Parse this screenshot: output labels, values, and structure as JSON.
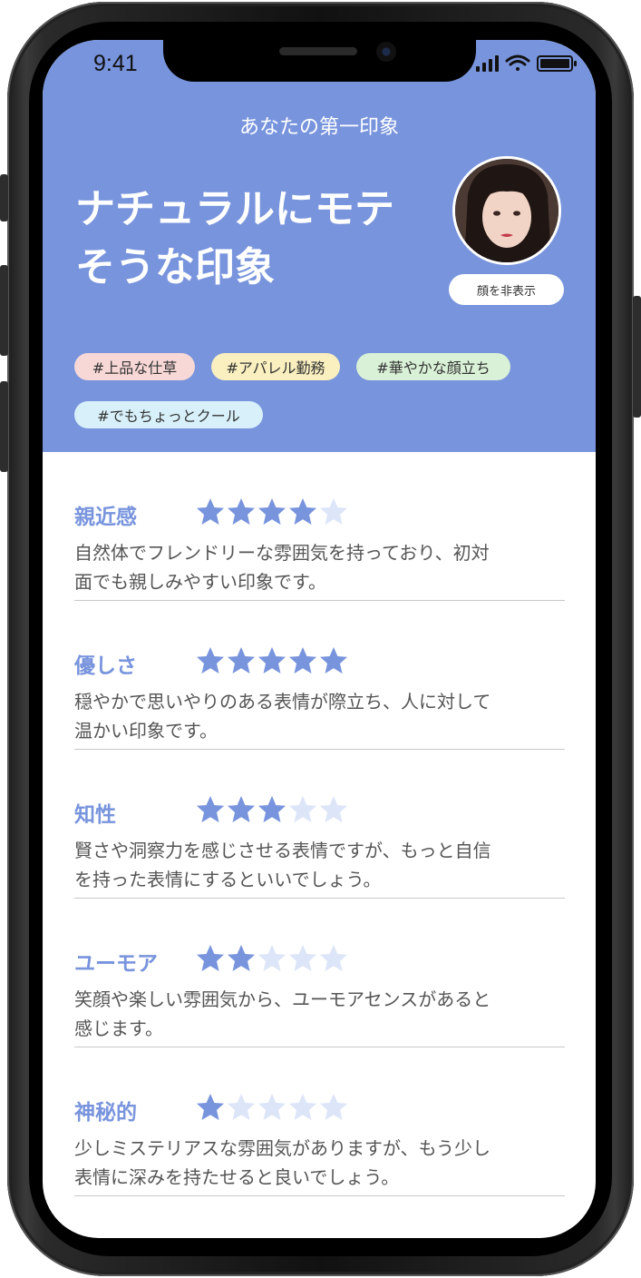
{
  "status_bar": {
    "time": "9:41"
  },
  "header": {
    "title": "あなたの第一印象",
    "headline_line1": "ナチュラルにモテ",
    "headline_line2": "そうな印象",
    "hide_face_label": "顔を非表示",
    "tags": [
      "#上品な仕草",
      "#アパレル勤務",
      "#華やかな顔立ち",
      "#でもちょっとクール"
    ]
  },
  "colors": {
    "accent": "#7894dd",
    "star_on": "#7894dd",
    "star_off": "#dde5f8"
  },
  "ratings": [
    {
      "label": "親近感",
      "stars": 4,
      "max": 5,
      "line1": "自然体でフレンドリーな雰囲気を持っており、初対",
      "line2": "面でも親しみやすい印象です。"
    },
    {
      "label": "優しさ",
      "stars": 5,
      "max": 5,
      "line1": "穏やかで思いやりのある表情が際立ち、人に対して",
      "line2": "温かい印象です。"
    },
    {
      "label": "知性",
      "stars": 3,
      "max": 5,
      "line1": "賢さや洞察力を感じさせる表情ですが、もっと自信",
      "line2": "を持った表情にするといいでしょう。"
    },
    {
      "label": "ユーモア",
      "stars": 2,
      "max": 5,
      "line1": "笑顔や楽しい雰囲気から、ユーモアセンスがあると",
      "line2": "感じます。"
    },
    {
      "label": "神秘的",
      "stars": 1,
      "max": 5,
      "line1": "少しミステリアスな雰囲気がありますが、もう少し",
      "line2": "表情に深みを持たせると良いでしょう。"
    }
  ]
}
